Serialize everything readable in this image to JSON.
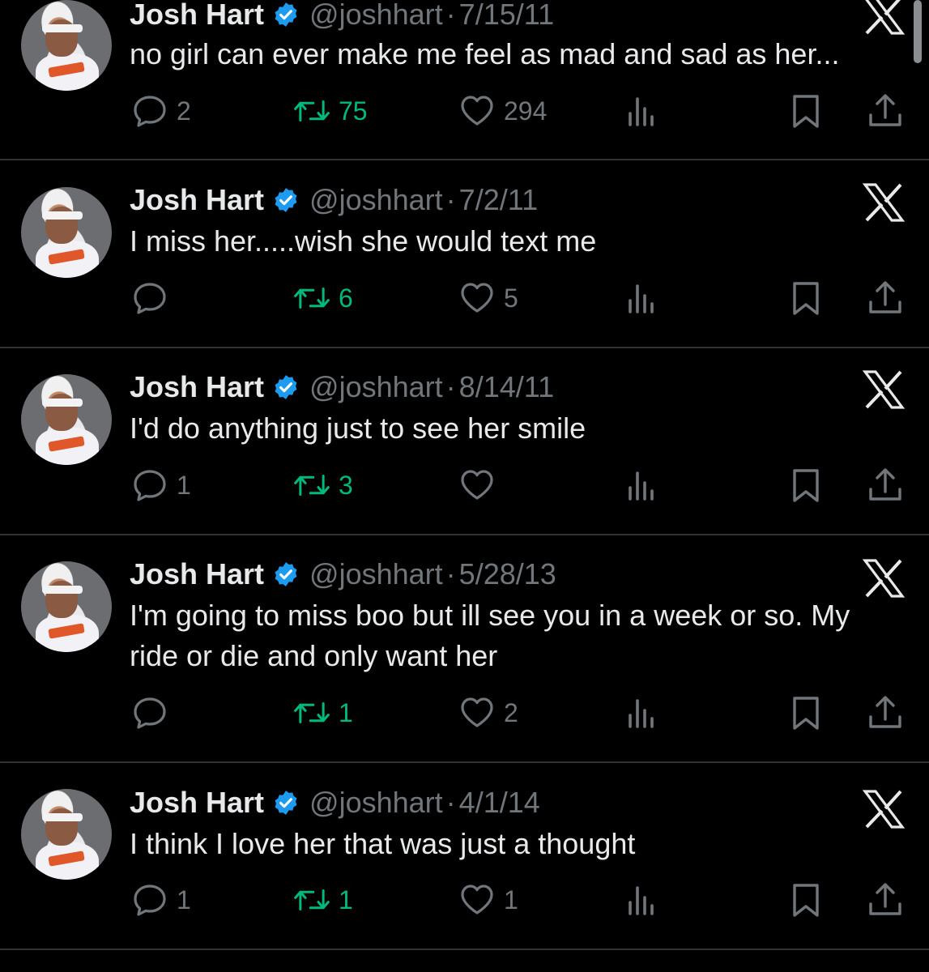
{
  "tweets": [
    {
      "name": "Josh Hart",
      "handle": "@joshhart",
      "separator": "·",
      "date": "7/15/11",
      "text": "no girl can ever make me feel as mad and sad as her...",
      "replies": "2",
      "retweets": "75",
      "likes": "294"
    },
    {
      "name": "Josh Hart",
      "handle": "@joshhart",
      "separator": "·",
      "date": "7/2/11",
      "text": "I miss her.....wish she would text me",
      "replies": "",
      "retweets": "6",
      "likes": "5"
    },
    {
      "name": "Josh Hart",
      "handle": "@joshhart",
      "separator": "·",
      "date": "8/14/11",
      "text": "I'd do anything just to see her smile",
      "replies": "1",
      "retweets": "3",
      "likes": ""
    },
    {
      "name": "Josh Hart",
      "handle": "@joshhart",
      "separator": "·",
      "date": "5/28/13",
      "text": "I'm going to miss boo but ill see you in a week or so. My\nride or die and only want her",
      "replies": "",
      "retweets": "1",
      "likes": "2"
    },
    {
      "name": "Josh Hart",
      "handle": "@joshhart",
      "separator": "·",
      "date": "4/1/14",
      "text": "I think I love her that was just a thought",
      "replies": "1",
      "retweets": "1",
      "likes": "1"
    }
  ],
  "colors": {
    "background": "#000000",
    "text": "#e7e9ea",
    "muted": "#71767b",
    "retweet_green": "#00ba7c",
    "verified_blue": "#1d9bf0",
    "divider": "#2f3336"
  },
  "icons": [
    "reply-icon",
    "retweet-icon",
    "like-icon",
    "views-icon",
    "bookmark-icon",
    "share-icon",
    "x-logo-icon",
    "verified-badge-icon"
  ]
}
